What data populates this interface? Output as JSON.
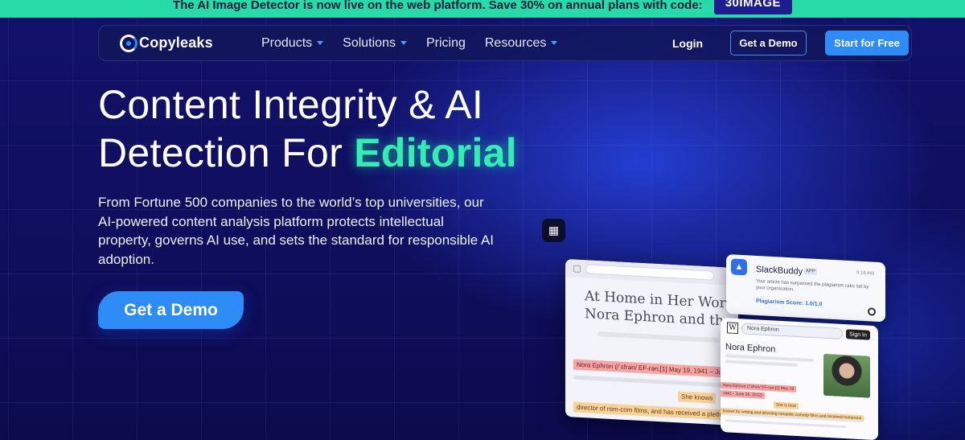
{
  "banner": {
    "text": "The AI Image Detector is now live on the web platform. Save 30% on annual plans with code:",
    "code": "30IMAGE"
  },
  "nav": {
    "logo": "Copyleaks",
    "menu": [
      {
        "label": "Products",
        "has_dropdown": true
      },
      {
        "label": "Solutions",
        "has_dropdown": true
      },
      {
        "label": "Pricing",
        "has_dropdown": false
      },
      {
        "label": "Resources",
        "has_dropdown": true
      }
    ],
    "login": "Login",
    "demo_button": "Get a Demo",
    "start_button": "Start for Free"
  },
  "hero": {
    "title_line1": "Content Integrity & AI",
    "title_line2_prefix": "Detection For ",
    "title_highlight": "Editorial",
    "description": "From Fortune 500 companies to the world’s top universities, our AI-powered content analysis platform protects intellectual property, governs AI use, and sets the standard for responsible AI adoption.",
    "cta": "Get a Demo"
  },
  "mockups": {
    "article": {
      "title_line1": "At Home in Her Words",
      "title_line2": "Nora Ephron and the",
      "highlight1": "Nora Ephron (/ˈɛfrən/ EF-rən;[1] May 19, 1941 – June",
      "highlight2": "She knows",
      "highlight3": "director of rom-com films, and has received a plethora"
    },
    "slack": {
      "name": "SlackBuddy",
      "badge": "APP",
      "time": "9:16 AM",
      "message": "Your article has surpassed the plagiarism ratio set by your organization.",
      "score": "Plagiarism Score: 1.0/1.0"
    },
    "wiki": {
      "search": "Nora Ephron",
      "sign_in": "Sign In",
      "heading": "Nora Ephron",
      "hl1": "Nora Ephron (/ˈɛfrən/ EF-rən;[1] May 19",
      "hl2": "1941 - June 26, 2012)",
      "hl3": "She is best",
      "hl4": "known for writing and directing romantic comedy films and received numerous"
    }
  },
  "colors": {
    "banner_bg": "#27dba8",
    "accent_blue": "#2d8cf5",
    "highlight_green": "#2ff0b0",
    "page_bg": "#100f5c"
  }
}
